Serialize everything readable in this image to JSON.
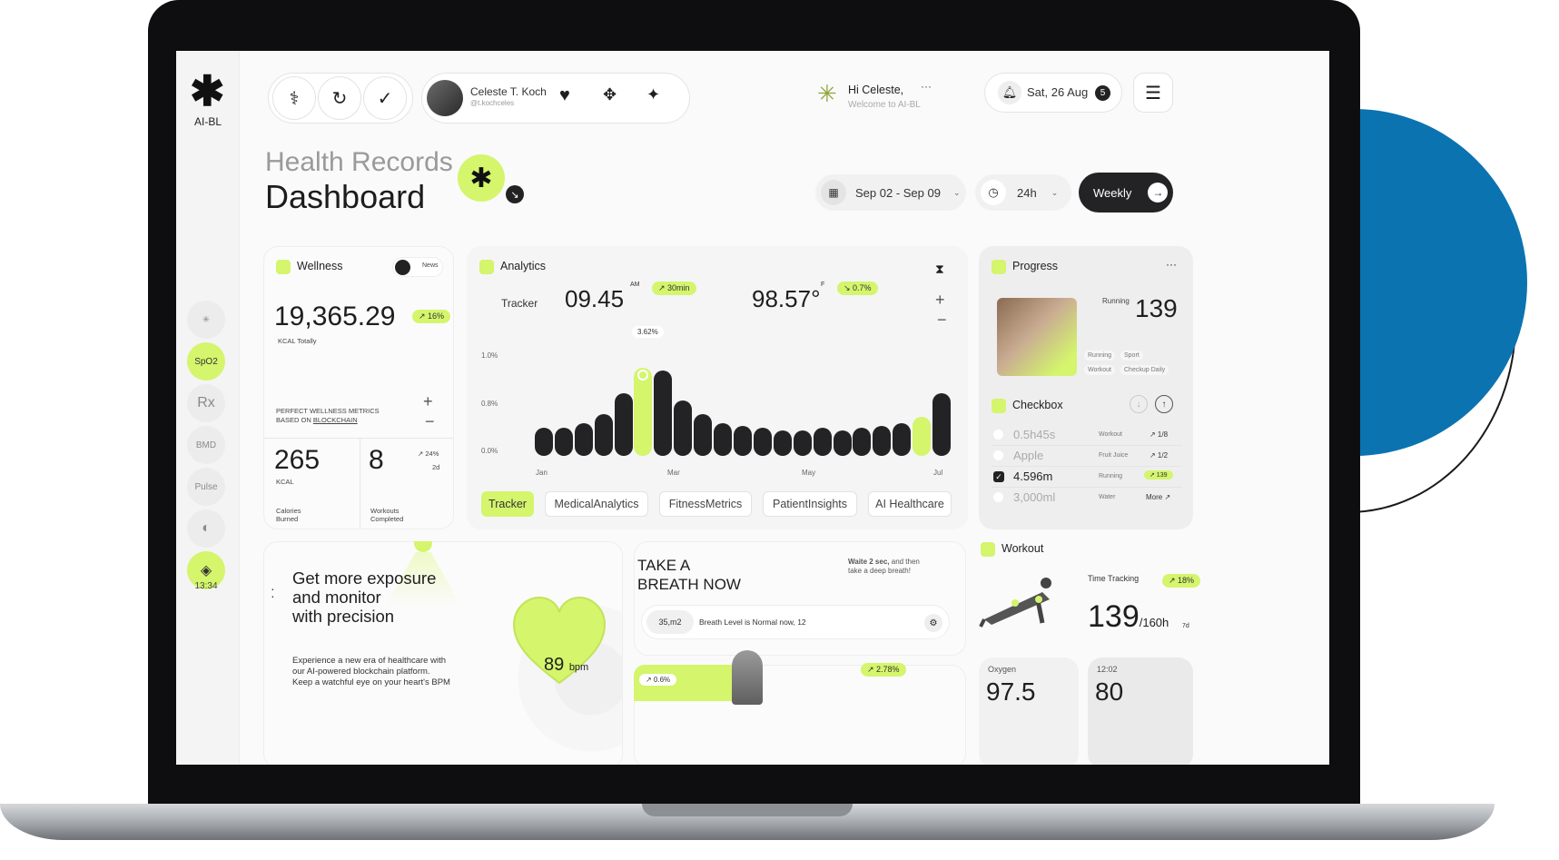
{
  "colors": {
    "accent": "#d4f56c",
    "dark": "#232326",
    "device_blue": "#0b73b0"
  },
  "sidebar": {
    "logo_text": "AI-BL",
    "items": [
      {
        "label": "",
        "icon": "asterisk-icon"
      },
      {
        "label": "SpO2",
        "icon": ""
      },
      {
        "label": "Rx",
        "icon": ""
      },
      {
        "label": "BMD",
        "icon": ""
      },
      {
        "label": "Pulse",
        "icon": ""
      },
      {
        "label": "",
        "icon": "brain-icon"
      },
      {
        "label": "",
        "icon": "layers-icon"
      }
    ],
    "time": "13:34"
  },
  "topbar": {
    "user_name": "Celeste T. Koch",
    "user_handle": "@t.kochceles",
    "greeting": "Hi Celeste,",
    "welcome": "Welcome to AI-BL",
    "date": "Sat, 26 Aug",
    "notif_count": "5"
  },
  "header": {
    "title_light": "Health Records",
    "title": "Dashboard",
    "date_range": "Sep 02 - Sep 09",
    "time_range": "24h",
    "period_button": "Weekly"
  },
  "wellness": {
    "title": "Wellness",
    "toggle_label": "News",
    "value": "19,365.29",
    "badge": "↗ 16%",
    "unit": "KCAL Totally",
    "note_line1": "PERFECT WELLNESS METRICS",
    "note_line2_prefix": "BASED ON ",
    "note_line2_link": "BLOCKCHAIN",
    "kcal_value": "265",
    "kcal_unit": "KCAL",
    "kcal_label_1": "Calories",
    "kcal_label_2": "Burned",
    "workouts_value": "8",
    "workouts_badge": "↗ 24%",
    "workouts_period": "2d",
    "workouts_label_1": "Workouts",
    "workouts_label_2": "Completed"
  },
  "analytics": {
    "title": "Analytics",
    "tracker_label": "Tracker",
    "time_value": "09.45",
    "time_suffix": "AM",
    "time_badge": "↗ 30min",
    "temp_value": "98.57°",
    "temp_suffix": "F",
    "temp_badge": "↘ 0.7%",
    "peak_label": "3.62%",
    "tabs": [
      "Tracker",
      "MedicalAnalytics",
      "FitnessMetrics",
      "PatientInsights",
      "AI Healthcare"
    ]
  },
  "chart_data": {
    "type": "bar",
    "ylabel": "",
    "xlabel": "",
    "y_ticks": [
      "1.0%",
      "0.8%",
      "0.0%"
    ],
    "x_ticks": [
      "Jan",
      "Mar",
      "May",
      "Jul"
    ],
    "ylim": [
      0,
      1.2
    ],
    "highlight": [
      5,
      19
    ],
    "values": [
      0.3,
      0.3,
      0.35,
      0.45,
      0.68,
      0.95,
      0.92,
      0.6,
      0.45,
      0.35,
      0.32,
      0.3,
      0.28,
      0.28,
      0.3,
      0.28,
      0.3,
      0.32,
      0.35,
      0.42,
      0.68
    ]
  },
  "progress": {
    "title": "Progress",
    "running_label": "Running",
    "running_value": "139",
    "tags": [
      "Running",
      "Sport",
      "Workout",
      "Checkup Daily"
    ]
  },
  "checkbox": {
    "title": "Checkbox",
    "rows": [
      {
        "value": "0.5h45s",
        "category": "Workout",
        "stat": "↗ 1/8",
        "checked": false
      },
      {
        "value": "Apple",
        "category": "Fruit Juice",
        "stat": "↗ 1/2",
        "checked": false
      },
      {
        "value": "4.596m",
        "category": "Running",
        "stat": "↗ 139",
        "checked": true
      },
      {
        "value": "3,000ml",
        "category": "Water",
        "stat": "More ↗",
        "checked": false
      }
    ]
  },
  "exposure": {
    "title_1": "Get more exposure",
    "title_2": "and monitor",
    "title_3": "with precision",
    "body_1": "Experience a new era of healthcare with",
    "body_2": "our AI-powered blockchain platform.",
    "body_3": "Keep a watchful eye on your heart's BPM",
    "bpm_value": "89",
    "bpm_unit": "bpm"
  },
  "breath": {
    "title_1": "TAKE A",
    "title_2": "BREATH NOW",
    "hint_bold": "Waite 2 sec,",
    "hint_rest_1": " and then",
    "hint_rest_2": "take a deep breath!",
    "chip_value": "35,m2",
    "status": "Breath Level is Normal now, 12",
    "badge_left": "↗ 0.6%",
    "badge_right": "↗ 2.78%"
  },
  "workout": {
    "title": "Workout",
    "tracking_label": "Time Tracking",
    "tracking_badge": "↗ 18%",
    "value": "139",
    "target": "/160h",
    "period": "7d"
  },
  "mini_cards": {
    "oxygen_label": "Oxygen",
    "oxygen_value": "97.5",
    "time_label": "12:02",
    "time_value": "80"
  }
}
